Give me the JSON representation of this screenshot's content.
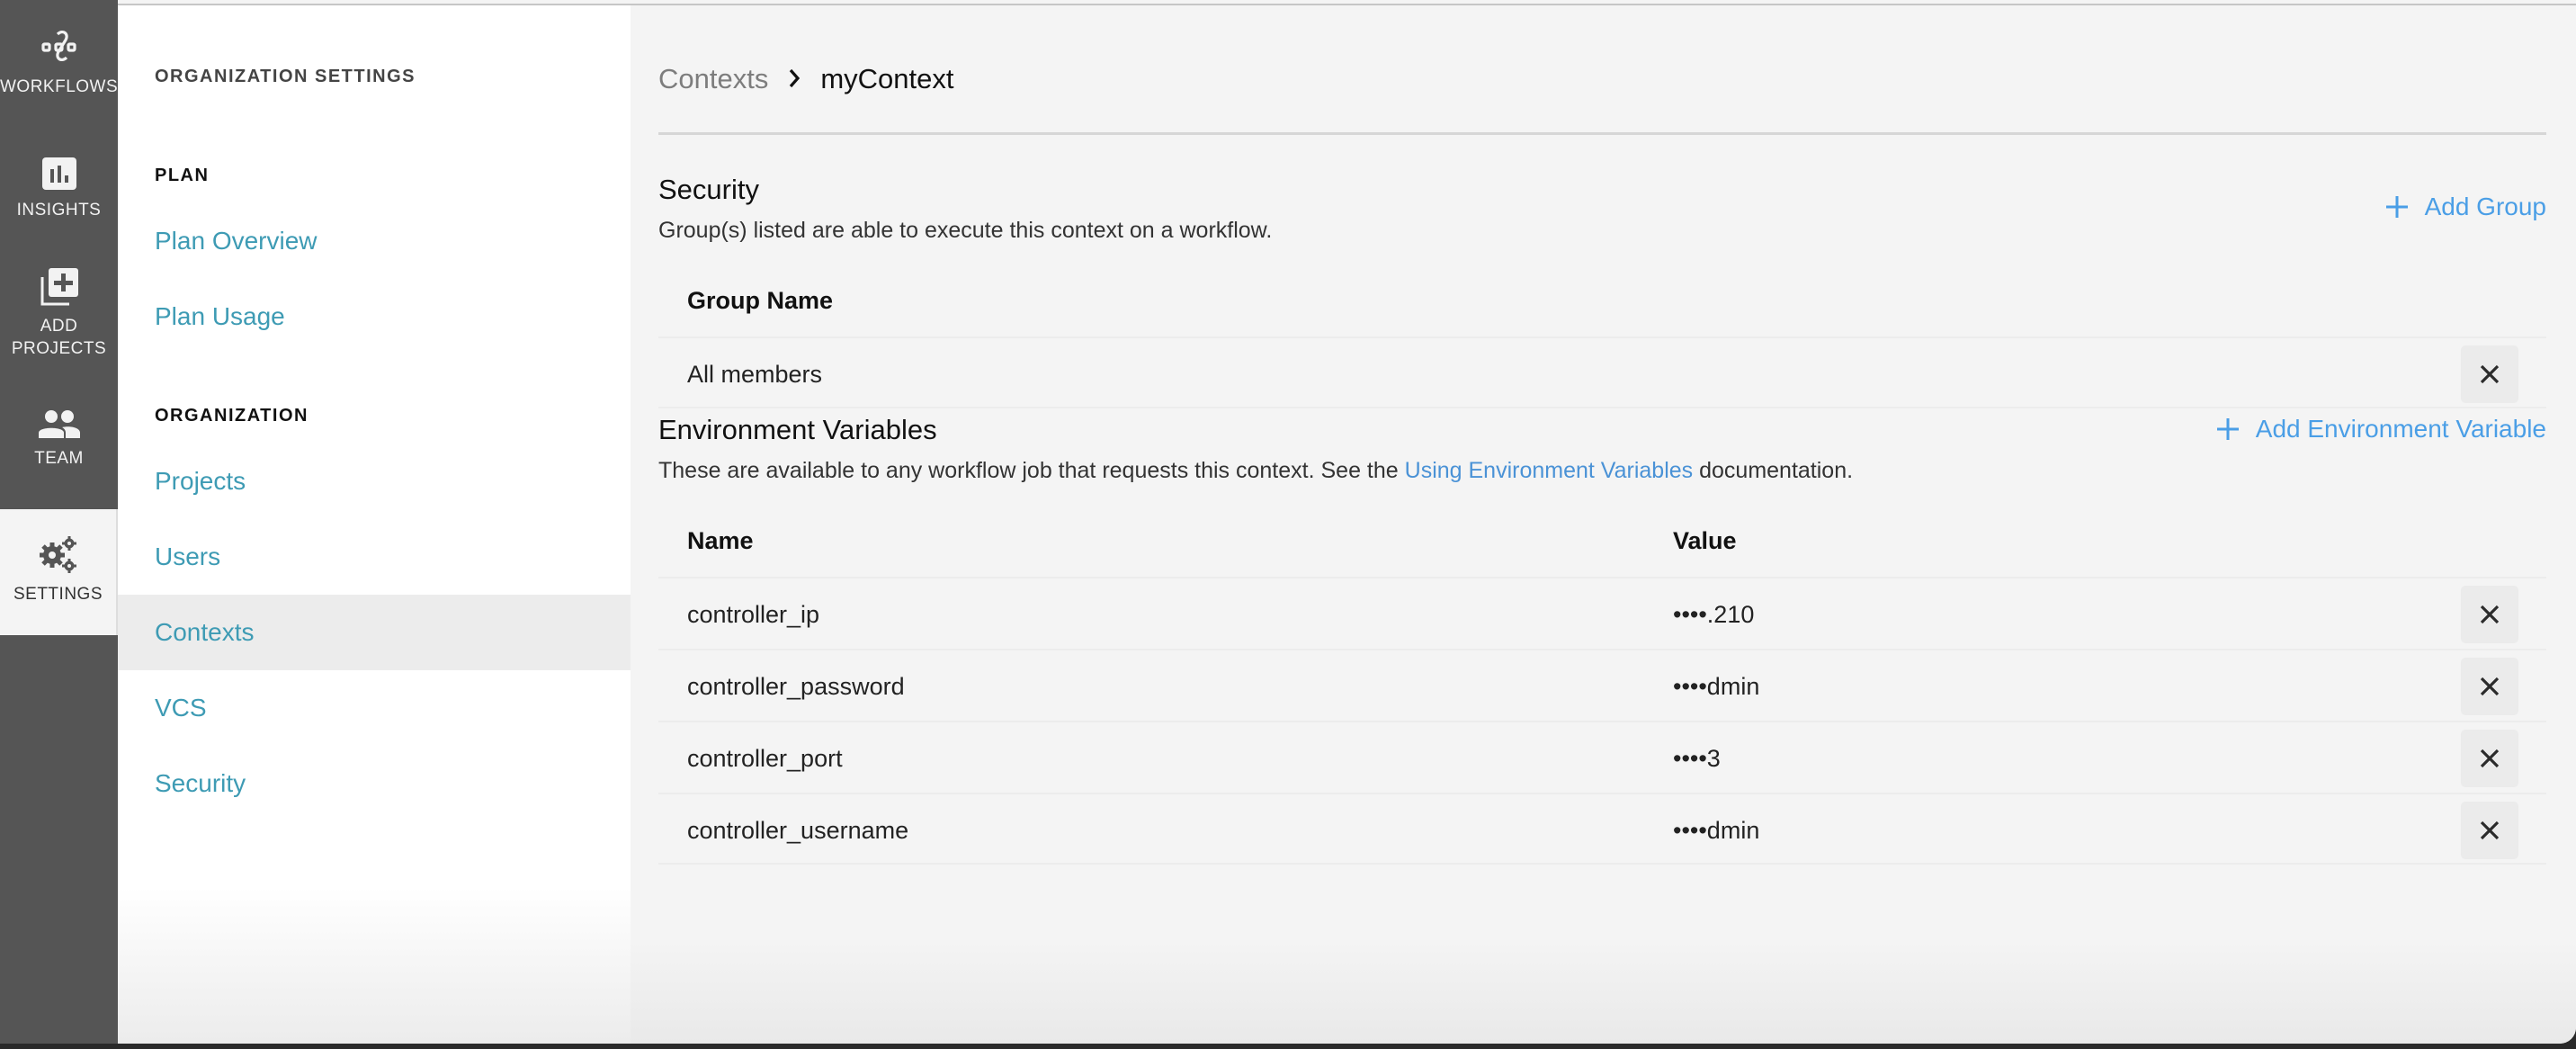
{
  "nav": {
    "items": [
      {
        "label": "WORKFLOWS",
        "icon": "workflows-icon"
      },
      {
        "label": "INSIGHTS",
        "icon": "insights-icon"
      },
      {
        "label": "ADD\nPROJECTS",
        "label_line1": "ADD",
        "label_line2": "PROJECTS",
        "icon": "add-projects-icon"
      },
      {
        "label": "TEAM",
        "icon": "team-icon"
      },
      {
        "label": "SETTINGS",
        "icon": "settings-gears-icon",
        "active": true
      }
    ]
  },
  "settings_panel": {
    "title": "ORGANIZATION SETTINGS",
    "sections": [
      {
        "heading": "PLAN",
        "links": [
          "Plan Overview",
          "Plan Usage"
        ]
      },
      {
        "heading": "ORGANIZATION",
        "links": [
          "Projects",
          "Users",
          "Contexts",
          "VCS",
          "Security"
        ]
      }
    ],
    "active_link": "Contexts"
  },
  "breadcrumb": {
    "parent": "Contexts",
    "separator_icon": "chevron-right-icon",
    "current": "myContext"
  },
  "security": {
    "title": "Security",
    "description": "Group(s) listed are able to execute this context on a workflow.",
    "add_button": "Add Group",
    "table": {
      "headers": [
        "Group Name"
      ],
      "rows": [
        [
          "All members"
        ]
      ]
    }
  },
  "env_vars": {
    "title": "Environment Variables",
    "description_before": "These are available to any workflow job that requests this context. See the ",
    "description_link": "Using Environment Variables",
    "description_after": " documentation.",
    "add_button": "Add Environment Variable",
    "table": {
      "headers": [
        "Name",
        "Value"
      ],
      "rows": [
        [
          "controller_ip",
          "••••.210"
        ],
        [
          "controller_password",
          "••••dmin"
        ],
        [
          "controller_port",
          "••••3"
        ],
        [
          "controller_username",
          "••••dmin"
        ]
      ]
    }
  },
  "colors": {
    "nav_bg": "#555555",
    "sidebar_link": "#3e9bb4",
    "action_link": "#4a9ee6",
    "main_bg": "#f4f4f4"
  }
}
